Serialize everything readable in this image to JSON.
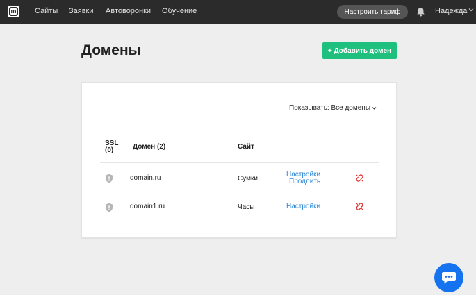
{
  "topbar": {
    "logo_letter": "m",
    "nav": [
      "Сайты",
      "Заявки",
      "Автоворонки",
      "Обучение"
    ],
    "tariff_button": "Настроить тариф",
    "user_name": "Надежда"
  },
  "page": {
    "title": "Домены",
    "add_button": "+ Добавить домен"
  },
  "filter": {
    "label": "Показывать: Все домены"
  },
  "table": {
    "headers": {
      "ssl_line1": "SSL",
      "ssl_line2": "(0)",
      "domain": "Домен (2)",
      "site": "Сайт"
    },
    "rows": [
      {
        "domain": "domain.ru",
        "site": "Сумки",
        "settings": "Настройки",
        "extend": "Продлить"
      },
      {
        "domain": "domain1.ru",
        "site": "Часы",
        "settings": "Настройки"
      }
    ]
  },
  "colors": {
    "topbar": "#2b2b2b",
    "accent_green": "#1fbf7d",
    "link_blue": "#2a86d6",
    "unlink_red": "#e0322e",
    "chat_blue": "#1673f0"
  }
}
